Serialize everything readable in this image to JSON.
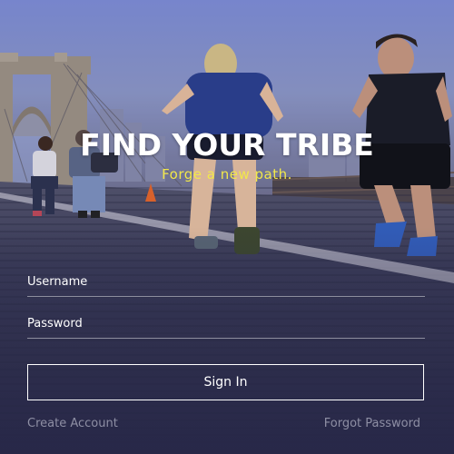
{
  "header": {
    "title": "FIND YOUR TRIBE",
    "tagline": "Forge a new path."
  },
  "form": {
    "username_label": "Username",
    "username_value": "",
    "password_label": "Password",
    "password_value": "",
    "sign_in_label": "Sign In"
  },
  "footer": {
    "create_account_label": "Create Account",
    "forgot_password_label": "Forgot Password"
  },
  "colors": {
    "title": "#ffffff",
    "tagline": "#f2e84a",
    "button_border": "#ffffff",
    "secondary_link": "#8e8fa4"
  }
}
